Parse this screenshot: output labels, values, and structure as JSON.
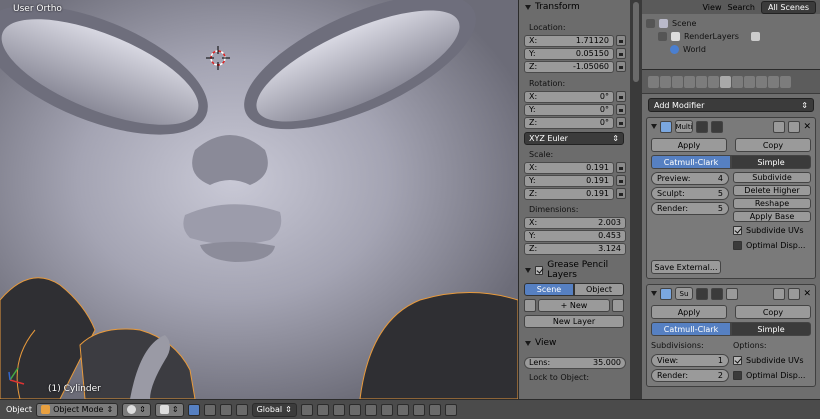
{
  "viewport": {
    "view_label": "User Ortho",
    "object_label": "(1) Cylinder"
  },
  "npanel": {
    "transform_header": "Transform",
    "location_label": "Location:",
    "location": [
      {
        "axis": "X:",
        "value": "1.71120"
      },
      {
        "axis": "Y:",
        "value": "0.05150"
      },
      {
        "axis": "Z:",
        "value": "-1.05060"
      }
    ],
    "rotation_label": "Rotation:",
    "rotation": [
      {
        "axis": "X:",
        "value": "0°"
      },
      {
        "axis": "Y:",
        "value": "0°"
      },
      {
        "axis": "Z:",
        "value": "0°"
      }
    ],
    "rotation_mode": "XYZ Euler",
    "scale_label": "Scale:",
    "scale": [
      {
        "axis": "X:",
        "value": "0.191"
      },
      {
        "axis": "Y:",
        "value": "0.191"
      },
      {
        "axis": "Z:",
        "value": "0.191"
      }
    ],
    "dimensions_label": "Dimensions:",
    "dimensions": [
      {
        "axis": "X:",
        "value": "2.003"
      },
      {
        "axis": "Y:",
        "value": "0.453"
      },
      {
        "axis": "Z:",
        "value": "3.124"
      }
    ],
    "grease_header": "Grease Pencil Layers",
    "scene_tab": "Scene",
    "object_tab": "Object",
    "new_btn": "New",
    "new_layer_btn": "New Layer",
    "view_header": "View",
    "lens_label": "Lens:",
    "lens_value": "35.000",
    "lock_label": "Lock to Object:"
  },
  "outliner": {
    "view": "View",
    "search": "Search",
    "scenes": "All Scenes",
    "scene": "Scene",
    "render_layers": "RenderLayers",
    "world": "World"
  },
  "properties": {
    "add_modifier": "Add Modifier",
    "mod1": {
      "name": "Multi",
      "apply": "Apply",
      "copy": "Copy",
      "catmull": "Catmull-Clark",
      "simple": "Simple",
      "preview_label": "Preview:",
      "preview": "4",
      "sculpt_label": "Sculpt:",
      "sculpt": "5",
      "render_label": "Render:",
      "render": "5",
      "subdivide": "Subdivide",
      "delete_higher": "Delete Higher",
      "reshape": "Reshape",
      "apply_base": "Apply Base",
      "subdivide_uvs": "Subdivide UVs",
      "optimal_display": "Optimal Disp...",
      "save_external": "Save External..."
    },
    "mod2": {
      "name": "Su",
      "apply": "Apply",
      "copy": "Copy",
      "catmull": "Catmull-Clark",
      "simple": "Simple",
      "subdivisions_label": "Subdivisions:",
      "options_label": "Options:",
      "view_label": "View:",
      "view": "1",
      "render_label": "Render:",
      "render": "2",
      "subdivide_uvs": "Subdivide UVs",
      "optimal_display": "Optimal Disp..."
    }
  },
  "bottombar": {
    "object_menu": "Object",
    "mode": "Object Mode",
    "orientation": "Global"
  }
}
